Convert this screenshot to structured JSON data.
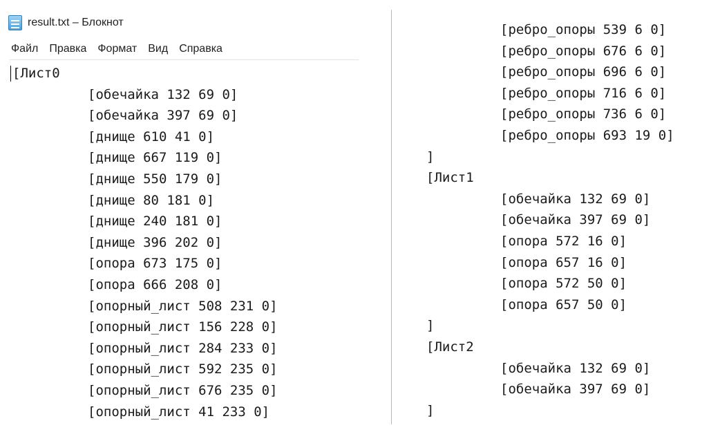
{
  "window": {
    "title": "result.txt – Блокнот",
    "icon": "notepad-icon"
  },
  "menu": [
    "Файл",
    "Правка",
    "Формат",
    "Вид",
    "Справка"
  ],
  "editor": {
    "left_lines": [
      {
        "text": "[Лист0",
        "level": 0
      },
      {
        "text": "[обечайка 132 69 0]",
        "level": 1
      },
      {
        "text": "[обечайка 397 69 0]",
        "level": 1
      },
      {
        "text": "[днище 610 41 0]",
        "level": 1
      },
      {
        "text": "[днище 667 119 0]",
        "level": 1
      },
      {
        "text": "[днище 550 179 0]",
        "level": 1
      },
      {
        "text": "[днище 80 181 0]",
        "level": 1
      },
      {
        "text": "[днище 240 181 0]",
        "level": 1
      },
      {
        "text": "[днище 396 202 0]",
        "level": 1
      },
      {
        "text": "[опора 673 175 0]",
        "level": 1
      },
      {
        "text": "[опора 666 208 0]",
        "level": 1
      },
      {
        "text": "[опорный_лист 508 231 0]",
        "level": 1
      },
      {
        "text": "[опорный_лист 156 228 0]",
        "level": 1
      },
      {
        "text": "[опорный_лист 284 233 0]",
        "level": 1
      },
      {
        "text": "[опорный_лист 592 235 0]",
        "level": 1
      },
      {
        "text": "[опорный_лист 676 235 0]",
        "level": 1
      },
      {
        "text": "[опорный_лист 41 233 0]",
        "level": 1
      }
    ],
    "right_lines": [
      {
        "text": "[ребро_опоры 539 6 0]",
        "level": 1
      },
      {
        "text": "[ребро_опоры 676 6 0]",
        "level": 1
      },
      {
        "text": "[ребро_опоры 696 6 0]",
        "level": 1
      },
      {
        "text": "[ребро_опоры 716 6 0]",
        "level": 1
      },
      {
        "text": "[ребро_опоры 736 6 0]",
        "level": 1
      },
      {
        "text": "[ребро_опоры 693 19 0]",
        "level": 1
      },
      {
        "text": "]",
        "level": 0
      },
      {
        "text": "[Лист1",
        "level": 0
      },
      {
        "text": "[обечайка 132 69 0]",
        "level": 1
      },
      {
        "text": "[обечайка 397 69 0]",
        "level": 1
      },
      {
        "text": "[опора 572 16 0]",
        "level": 1
      },
      {
        "text": "[опора 657 16 0]",
        "level": 1
      },
      {
        "text": "[опора 572 50 0]",
        "level": 1
      },
      {
        "text": "[опора 657 50 0]",
        "level": 1
      },
      {
        "text": "]",
        "level": 0
      },
      {
        "text": "[Лист2",
        "level": 0
      },
      {
        "text": "[обечайка 132 69 0]",
        "level": 1
      },
      {
        "text": "[обечайка 397 69 0]",
        "level": 1
      },
      {
        "text": "]",
        "level": 0
      }
    ]
  }
}
